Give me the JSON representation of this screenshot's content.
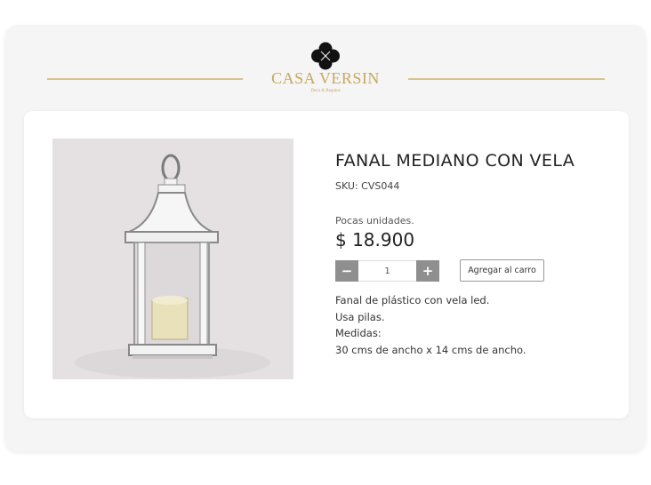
{
  "brand": {
    "name": "CASA VERSIN",
    "tagline": "Deco & Regalos",
    "accent_color": "#c8a85a",
    "logo_icon": "flower-logo-icon"
  },
  "product": {
    "title": "FANAL MEDIANO CON VELA",
    "sku": "SKU: CVS044",
    "stock_note": "Pocas unidades.",
    "price": "$ 18.900",
    "image_icon": "lantern-with-candle-image",
    "quantity": {
      "value": "1",
      "minus_label": "−",
      "plus_label": "+"
    },
    "add_to_cart_label": "Agregar al carro",
    "description": [
      "Fanal de plástico con vela led.",
      "Usa pilas.",
      "Medidas:",
      "30 cms de ancho x 14 cms de ancho."
    ]
  }
}
